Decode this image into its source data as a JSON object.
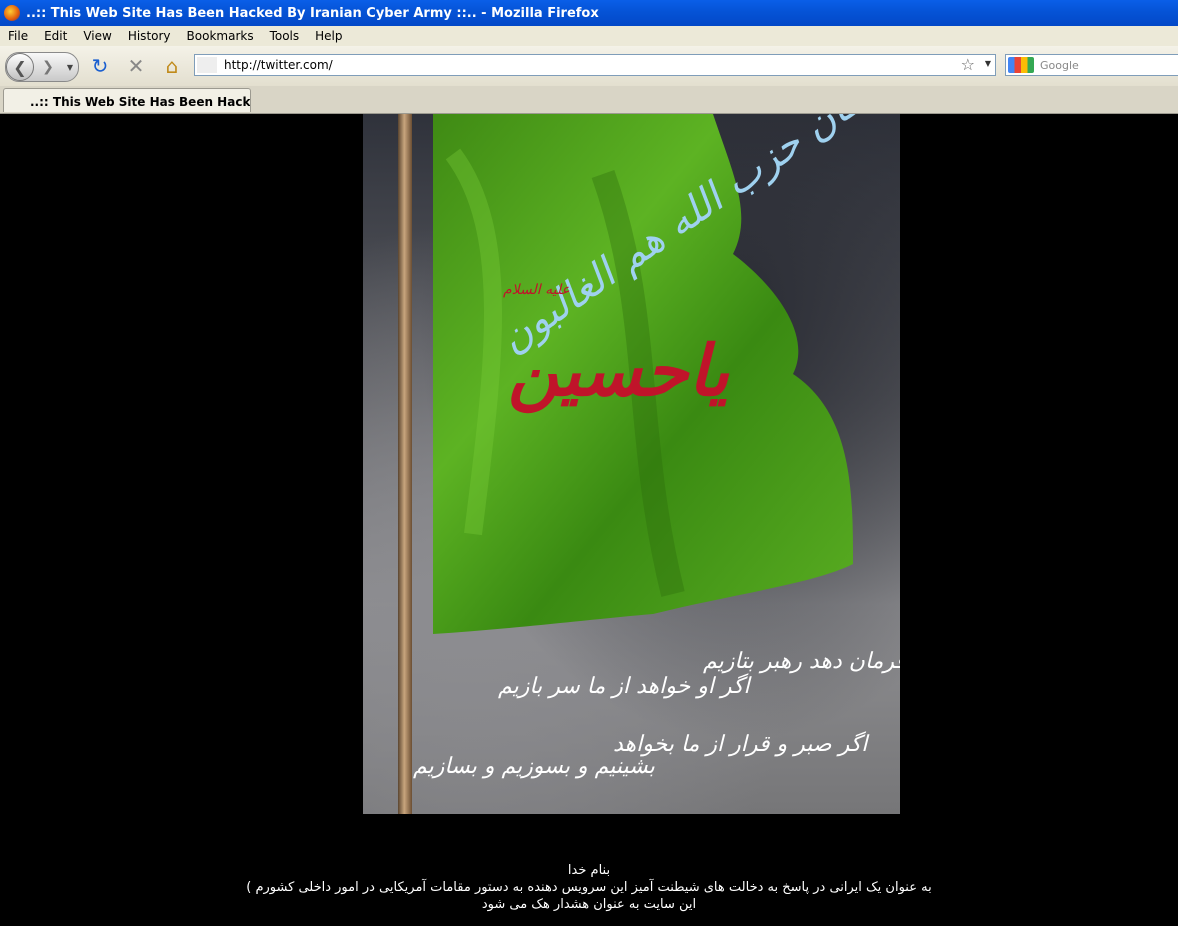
{
  "window": {
    "title": "..:: This Web Site Has Been Hacked By Iranian Cyber Army ::.. - Mozilla Firefox"
  },
  "menu": [
    "File",
    "Edit",
    "View",
    "History",
    "Bookmarks",
    "Tools",
    "Help"
  ],
  "navbar": {
    "url": "http://twitter.com/",
    "search_placeholder": "Google"
  },
  "tab": {
    "label": "..:: This Web Site Has Been Hacked B..."
  },
  "poster": {
    "calligraphy_top": "فان حزب الله هم الغالبون",
    "calligraphy_small": "علیه السلام",
    "calligraphy_main": "یاحسین",
    "poem_line1a": "اگر فرمان دهد رهبر بتازیم",
    "poem_line1b": "اگر او خواهد از ما سر بازیم",
    "poem_line2a": "اگر صبر و قرار از ما بخواهد",
    "poem_line2b": "بشینیم و بسوزیم و بسازیم"
  },
  "message": {
    "line1": "بنام خدا",
    "line2": "به عنوان یک ایرانی در پاسخ به دخالت های شیطنت آمیز این سرویس دهنده به دستور مقامات آمریکایی در امور داخلی کشورم )",
    "line3": "این سایت به عنوان هشدار هک می شود"
  }
}
